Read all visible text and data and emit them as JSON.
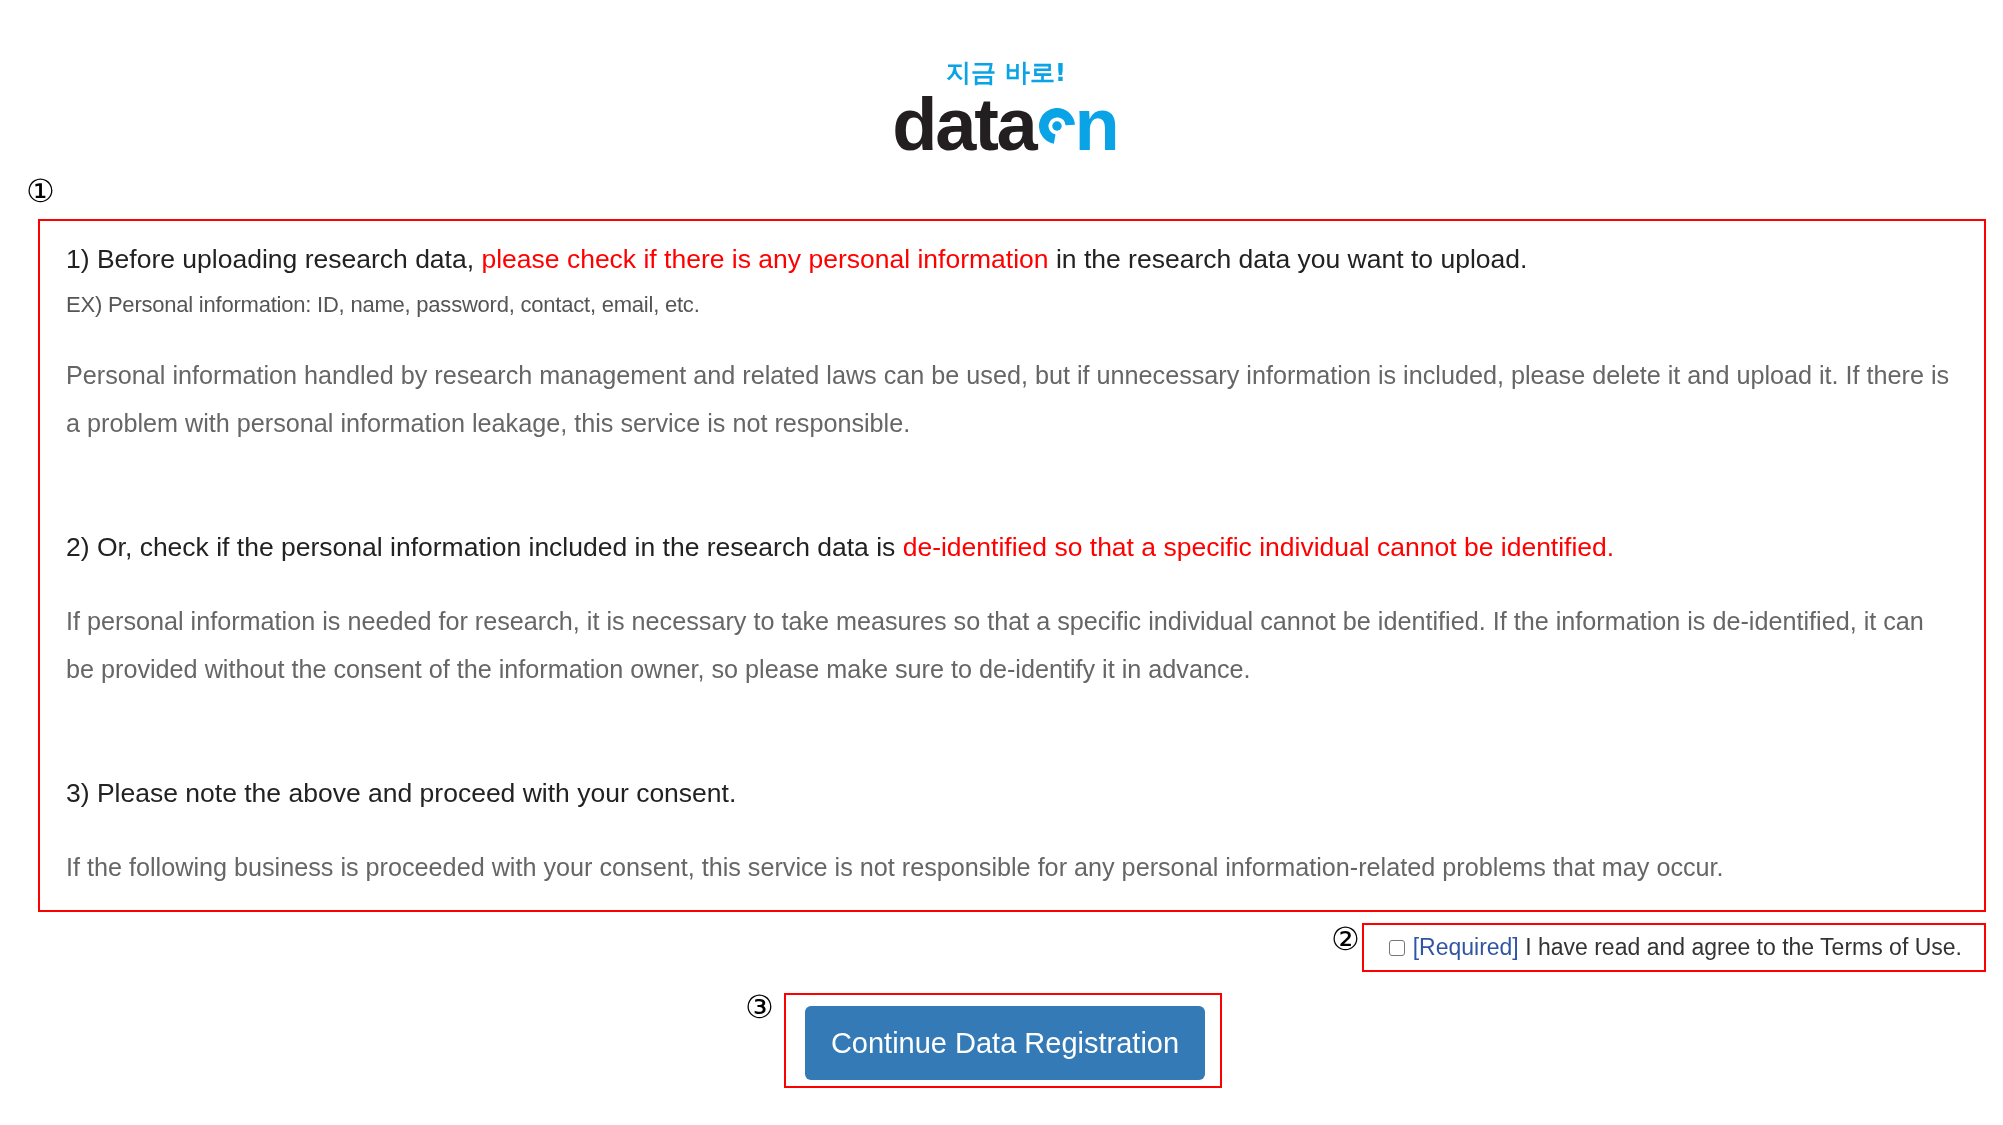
{
  "logo": {
    "tagline": "지금 바로!",
    "wordmark": "data",
    "wordmark_accent": "n"
  },
  "notice": {
    "marker": "①",
    "sections": [
      {
        "heading": [
          {
            "text": "1) Before uploading research data, ",
            "highlight": false
          },
          {
            "text": "please check if there is any personal information",
            "highlight": true
          },
          {
            "text": " in the research data you want to upload.",
            "highlight": false
          }
        ],
        "note": "EX) Personal information: ID, name, password, contact, email, etc.",
        "body": "Personal information handled by research management and related laws can be used, but if unnecessary information is included, please delete it and upload it. If there is a problem with personal information leakage, this service is not responsible."
      },
      {
        "heading": [
          {
            "text": "2) Or, check if the personal information included in the research data is ",
            "highlight": false
          },
          {
            "text": "de-identified so that a specific individual cannot be identified.",
            "highlight": true
          }
        ],
        "body": "If personal information is needed for research, it is necessary to take measures so that a specific individual cannot be identified. If the information is de-identified, it can be provided without the consent of the information owner, so please make sure to de-identify it in advance."
      },
      {
        "heading": [
          {
            "text": "3) Please note the above and proceed with your consent.",
            "highlight": false
          }
        ],
        "body": "If the following business is proceeded with your consent, this service is not responsible for any personal information-related problems that may occur."
      }
    ]
  },
  "agreement": {
    "marker": "②",
    "checked": false,
    "tag": "[Required]",
    "label": "I have read and agree to the Terms of Use."
  },
  "submit": {
    "marker": "③",
    "label": "Continue Data Registration"
  }
}
